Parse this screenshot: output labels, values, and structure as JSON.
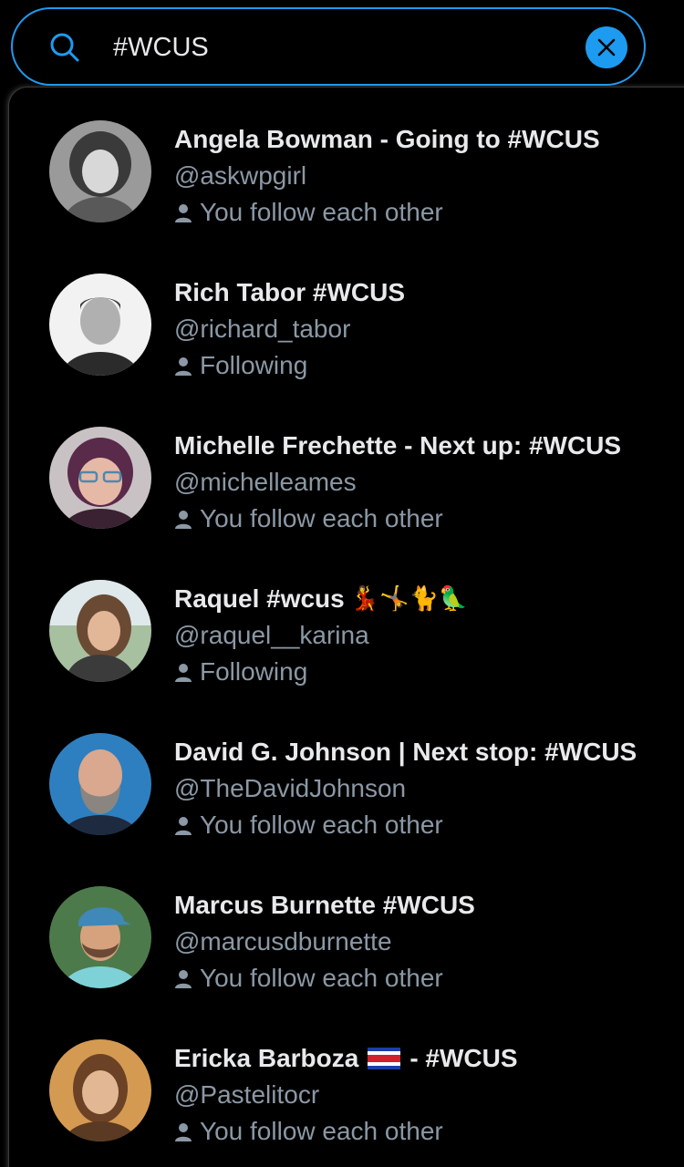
{
  "search": {
    "value": "#WCUS",
    "clear_label": "Clear"
  },
  "results": [
    {
      "name_prefix": "Angela Bowman - Going to #WCUS",
      "name_suffix": "",
      "emoji": "",
      "handle": "@askwpgirl",
      "relationship": "You follow each other"
    },
    {
      "name_prefix": "Rich Tabor #WCUS",
      "name_suffix": "",
      "emoji": "",
      "handle": "@richard_tabor",
      "relationship": "Following"
    },
    {
      "name_prefix": "Michelle Frechette - Next up: #WCUS",
      "name_suffix": "",
      "emoji": "",
      "handle": "@michelleames",
      "relationship": "You follow each other"
    },
    {
      "name_prefix": "Raquel #wcus",
      "name_suffix": "",
      "emoji": "💃🤸🐈🦜",
      "handle": "@raquel__karina",
      "relationship": "Following"
    },
    {
      "name_prefix": "David G. Johnson | Next stop: #WCUS",
      "name_suffix": "",
      "emoji": "",
      "handle": "@TheDavidJohnson",
      "relationship": "You follow each other"
    },
    {
      "name_prefix": "Marcus Burnette #WCUS",
      "name_suffix": "",
      "emoji": "",
      "handle": "@marcusdburnette",
      "relationship": "You follow each other"
    },
    {
      "name_prefix": "Ericka Barboza",
      "name_suffix": "- #WCUS",
      "emoji": "",
      "handle": "@Pastelitocr",
      "relationship": "You follow each other"
    }
  ],
  "icons": {
    "search": "search-icon",
    "clear": "close-icon",
    "relationship": "person-icon",
    "flag": "costa-rica-flag-icon"
  },
  "colors": {
    "accent": "#1d9bf0",
    "background": "#000000",
    "primary_text": "#e7e9ea",
    "secondary_text": "#8b98a5"
  }
}
